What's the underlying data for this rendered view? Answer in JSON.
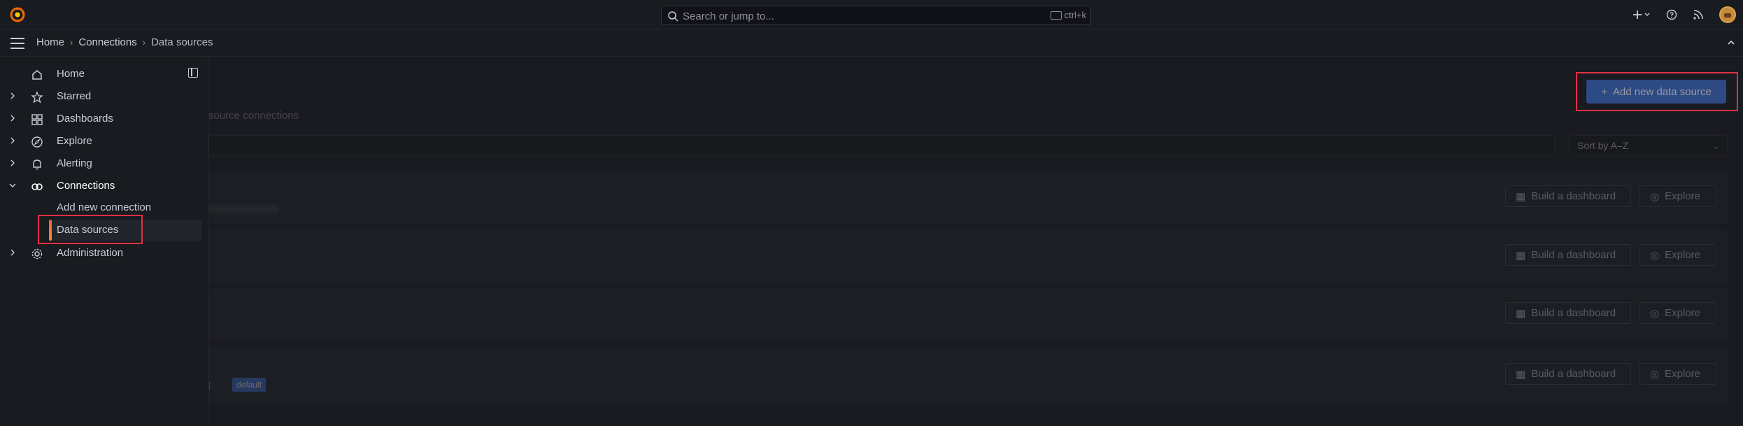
{
  "topbar": {
    "search_placeholder": "Search or jump to...",
    "shortcut": "ctrl+k",
    "icons": [
      "grafana-logo-icon",
      "plus-icon",
      "help-icon",
      "news-icon",
      "avatar"
    ]
  },
  "breadcrumb": [
    "Home",
    "Connections",
    "Data sources"
  ],
  "sidenav": {
    "items": [
      {
        "label": "Home",
        "icon": "home-icon"
      },
      {
        "label": "Starred",
        "icon": "star-icon"
      },
      {
        "label": "Dashboards",
        "icon": "dashboards-icon"
      },
      {
        "label": "Explore",
        "icon": "compass-icon"
      },
      {
        "label": "Alerting",
        "icon": "bell-icon"
      },
      {
        "label": "Connections",
        "icon": "connections-icon"
      },
      {
        "label": "Administration",
        "icon": "gear-icon"
      }
    ],
    "subitems": [
      {
        "label": "Add new connection"
      },
      {
        "label": "Data sources"
      }
    ]
  },
  "main": {
    "subtitle": "source connections",
    "sort_label": "Sort by A–Z",
    "add_button": "Add new data source",
    "default_badge": "default",
    "card_actions": {
      "build": "Build a dashboard",
      "explore": "Explore"
    }
  },
  "colors": {
    "accent": "#3d71d9",
    "highlight": "#e02f44",
    "active_bar": "#ff8833"
  }
}
